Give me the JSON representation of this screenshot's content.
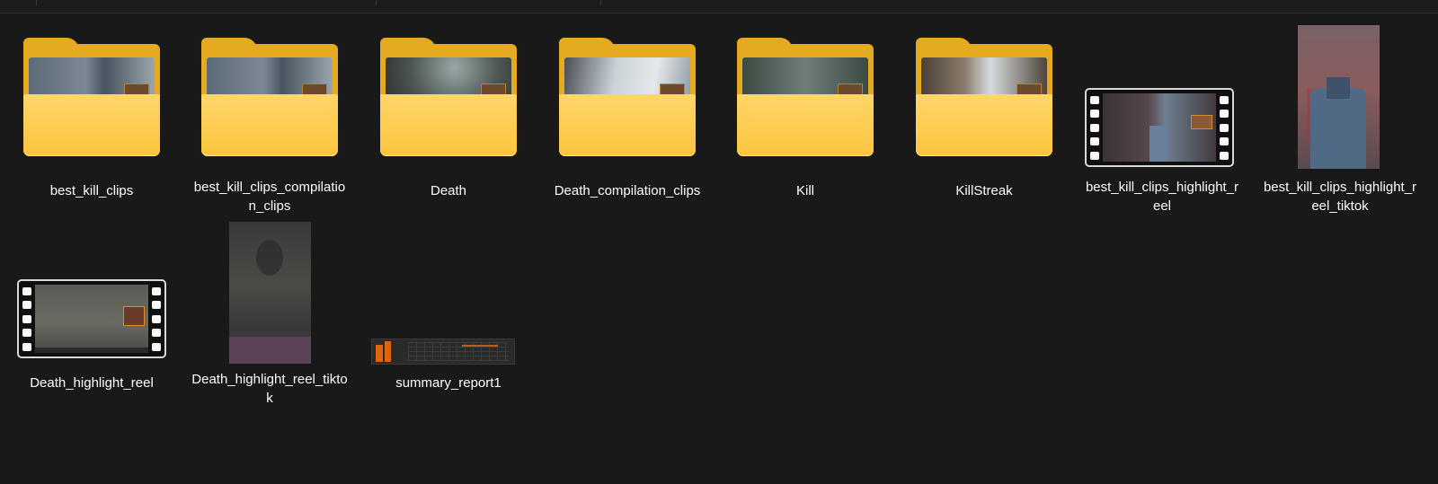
{
  "items": [
    {
      "name": "best_kill_clips",
      "type": "folder"
    },
    {
      "name": "best_kill_clips_compilation_clips",
      "type": "folder"
    },
    {
      "name": "Death",
      "type": "folder"
    },
    {
      "name": "Death_compilation_clips",
      "type": "folder"
    },
    {
      "name": "Kill",
      "type": "folder"
    },
    {
      "name": "KillStreak",
      "type": "folder"
    },
    {
      "name": "best_kill_clips_highlight_reel",
      "type": "video"
    },
    {
      "name": "best_kill_clips_highlight_reel_tiktok",
      "type": "video"
    },
    {
      "name": "Death_highlight_reel",
      "type": "video"
    },
    {
      "name": "Death_highlight_reel_tiktok",
      "type": "video"
    },
    {
      "name": "summary_report1",
      "type": "image"
    }
  ],
  "colors": {
    "background": "#191919",
    "folder": "#fcc43c",
    "folder_back": "#e6aa22",
    "report_bar": "#e0640a"
  },
  "icons": {
    "folder": "folder-icon",
    "video": "video-film-icon",
    "image": "image-thumbnail-icon"
  }
}
